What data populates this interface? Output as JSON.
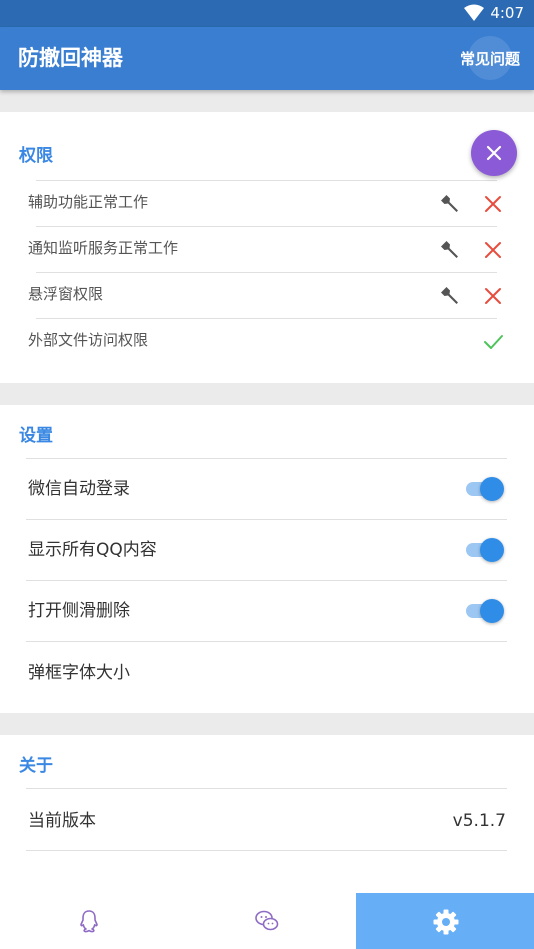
{
  "status_bar": {
    "time": "4:07"
  },
  "app_bar": {
    "title": "防撤回神器",
    "faq_label": "常见问题"
  },
  "permissions": {
    "title": "权限",
    "items": [
      {
        "label": "辅助功能正常工作",
        "status": "error"
      },
      {
        "label": "通知监听服务正常工作",
        "status": "error"
      },
      {
        "label": "悬浮窗权限",
        "status": "error"
      },
      {
        "label": "外部文件访问权限",
        "status": "ok"
      }
    ]
  },
  "settings": {
    "title": "设置",
    "items": [
      {
        "label": "微信自动登录",
        "enabled": true
      },
      {
        "label": "显示所有QQ内容",
        "enabled": true
      },
      {
        "label": "打开侧滑删除",
        "enabled": true
      },
      {
        "label": "弹框字体大小"
      }
    ]
  },
  "about": {
    "title": "关于",
    "version_label": "当前版本",
    "version_value": "v5.1.7"
  },
  "bottom_nav": {
    "tabs": [
      {
        "icon": "qq-icon",
        "active": false
      },
      {
        "icon": "wechat-icon",
        "active": false
      },
      {
        "icon": "gear-icon",
        "active": true
      }
    ]
  },
  "colors": {
    "primary": "#3a7ed2",
    "status_bar": "#2c6bb3",
    "accent_blue": "#3a88e3",
    "fab": "#8b5ad6",
    "error_red": "#e74c3c",
    "ok_green": "#4cc45a",
    "nav_active": "#66aef5"
  }
}
